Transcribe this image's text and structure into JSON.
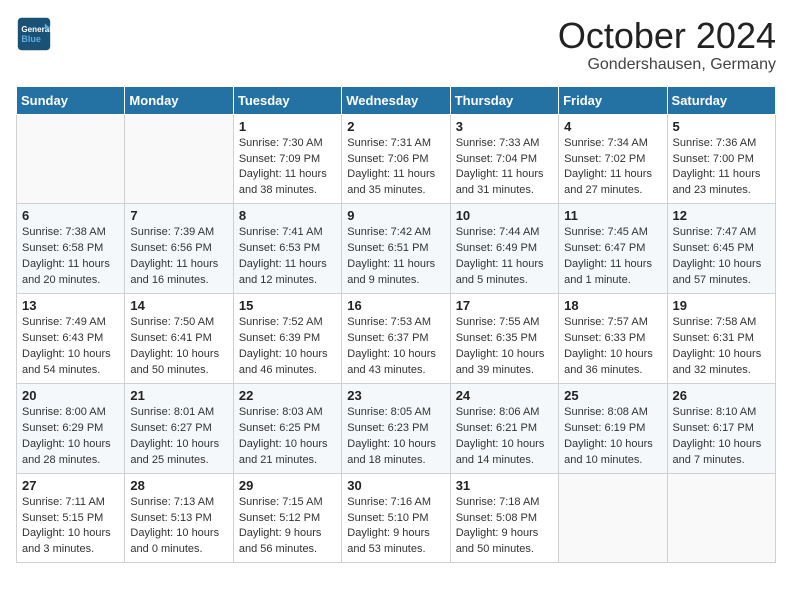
{
  "header": {
    "logo_general": "General",
    "logo_blue": "Blue",
    "month_title": "October 2024",
    "location": "Gondershausen, Germany"
  },
  "days_of_week": [
    "Sunday",
    "Monday",
    "Tuesday",
    "Wednesday",
    "Thursday",
    "Friday",
    "Saturday"
  ],
  "weeks": [
    [
      {
        "day": "",
        "info": ""
      },
      {
        "day": "",
        "info": ""
      },
      {
        "day": "1",
        "info": "Sunrise: 7:30 AM\nSunset: 7:09 PM\nDaylight: 11 hours and 38 minutes."
      },
      {
        "day": "2",
        "info": "Sunrise: 7:31 AM\nSunset: 7:06 PM\nDaylight: 11 hours and 35 minutes."
      },
      {
        "day": "3",
        "info": "Sunrise: 7:33 AM\nSunset: 7:04 PM\nDaylight: 11 hours and 31 minutes."
      },
      {
        "day": "4",
        "info": "Sunrise: 7:34 AM\nSunset: 7:02 PM\nDaylight: 11 hours and 27 minutes."
      },
      {
        "day": "5",
        "info": "Sunrise: 7:36 AM\nSunset: 7:00 PM\nDaylight: 11 hours and 23 minutes."
      }
    ],
    [
      {
        "day": "6",
        "info": "Sunrise: 7:38 AM\nSunset: 6:58 PM\nDaylight: 11 hours and 20 minutes."
      },
      {
        "day": "7",
        "info": "Sunrise: 7:39 AM\nSunset: 6:56 PM\nDaylight: 11 hours and 16 minutes."
      },
      {
        "day": "8",
        "info": "Sunrise: 7:41 AM\nSunset: 6:53 PM\nDaylight: 11 hours and 12 minutes."
      },
      {
        "day": "9",
        "info": "Sunrise: 7:42 AM\nSunset: 6:51 PM\nDaylight: 11 hours and 9 minutes."
      },
      {
        "day": "10",
        "info": "Sunrise: 7:44 AM\nSunset: 6:49 PM\nDaylight: 11 hours and 5 minutes."
      },
      {
        "day": "11",
        "info": "Sunrise: 7:45 AM\nSunset: 6:47 PM\nDaylight: 11 hours and 1 minute."
      },
      {
        "day": "12",
        "info": "Sunrise: 7:47 AM\nSunset: 6:45 PM\nDaylight: 10 hours and 57 minutes."
      }
    ],
    [
      {
        "day": "13",
        "info": "Sunrise: 7:49 AM\nSunset: 6:43 PM\nDaylight: 10 hours and 54 minutes."
      },
      {
        "day": "14",
        "info": "Sunrise: 7:50 AM\nSunset: 6:41 PM\nDaylight: 10 hours and 50 minutes."
      },
      {
        "day": "15",
        "info": "Sunrise: 7:52 AM\nSunset: 6:39 PM\nDaylight: 10 hours and 46 minutes."
      },
      {
        "day": "16",
        "info": "Sunrise: 7:53 AM\nSunset: 6:37 PM\nDaylight: 10 hours and 43 minutes."
      },
      {
        "day": "17",
        "info": "Sunrise: 7:55 AM\nSunset: 6:35 PM\nDaylight: 10 hours and 39 minutes."
      },
      {
        "day": "18",
        "info": "Sunrise: 7:57 AM\nSunset: 6:33 PM\nDaylight: 10 hours and 36 minutes."
      },
      {
        "day": "19",
        "info": "Sunrise: 7:58 AM\nSunset: 6:31 PM\nDaylight: 10 hours and 32 minutes."
      }
    ],
    [
      {
        "day": "20",
        "info": "Sunrise: 8:00 AM\nSunset: 6:29 PM\nDaylight: 10 hours and 28 minutes."
      },
      {
        "day": "21",
        "info": "Sunrise: 8:01 AM\nSunset: 6:27 PM\nDaylight: 10 hours and 25 minutes."
      },
      {
        "day": "22",
        "info": "Sunrise: 8:03 AM\nSunset: 6:25 PM\nDaylight: 10 hours and 21 minutes."
      },
      {
        "day": "23",
        "info": "Sunrise: 8:05 AM\nSunset: 6:23 PM\nDaylight: 10 hours and 18 minutes."
      },
      {
        "day": "24",
        "info": "Sunrise: 8:06 AM\nSunset: 6:21 PM\nDaylight: 10 hours and 14 minutes."
      },
      {
        "day": "25",
        "info": "Sunrise: 8:08 AM\nSunset: 6:19 PM\nDaylight: 10 hours and 10 minutes."
      },
      {
        "day": "26",
        "info": "Sunrise: 8:10 AM\nSunset: 6:17 PM\nDaylight: 10 hours and 7 minutes."
      }
    ],
    [
      {
        "day": "27",
        "info": "Sunrise: 7:11 AM\nSunset: 5:15 PM\nDaylight: 10 hours and 3 minutes."
      },
      {
        "day": "28",
        "info": "Sunrise: 7:13 AM\nSunset: 5:13 PM\nDaylight: 10 hours and 0 minutes."
      },
      {
        "day": "29",
        "info": "Sunrise: 7:15 AM\nSunset: 5:12 PM\nDaylight: 9 hours and 56 minutes."
      },
      {
        "day": "30",
        "info": "Sunrise: 7:16 AM\nSunset: 5:10 PM\nDaylight: 9 hours and 53 minutes."
      },
      {
        "day": "31",
        "info": "Sunrise: 7:18 AM\nSunset: 5:08 PM\nDaylight: 9 hours and 50 minutes."
      },
      {
        "day": "",
        "info": ""
      },
      {
        "day": "",
        "info": ""
      }
    ]
  ]
}
